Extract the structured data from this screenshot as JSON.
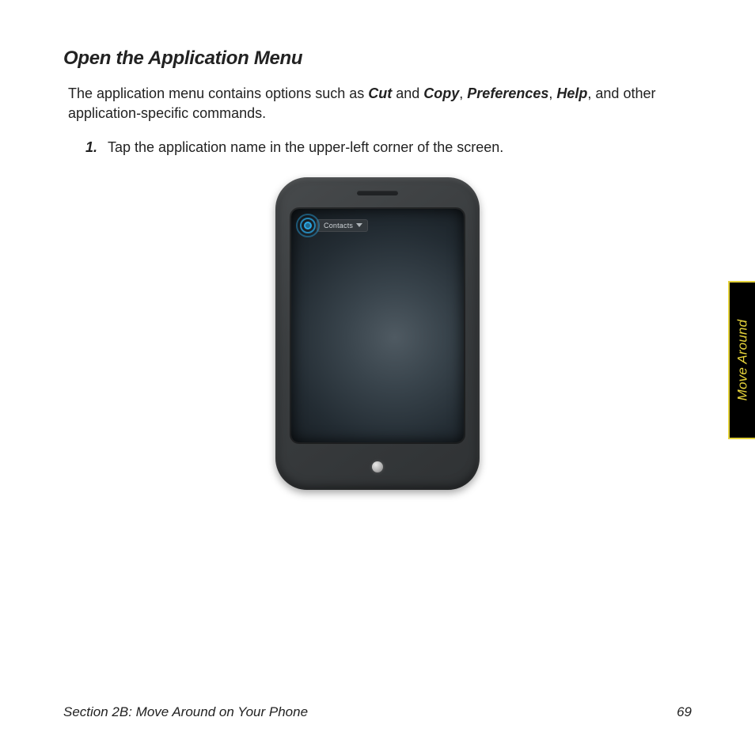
{
  "heading": "Open the Application Menu",
  "intro": {
    "pre": "The application menu contains options such as ",
    "em1": "Cut",
    "mid1": " and ",
    "em2": "Copy",
    "sep1": ", ",
    "em3": "Preferences",
    "sep2": ", ",
    "em4": "Help",
    "post": ", and other application-specific commands."
  },
  "steps": [
    {
      "num": "1.",
      "text": "Tap the application name in the upper-left corner of the screen."
    }
  ],
  "figure": {
    "app_menu_label": "Contacts"
  },
  "side_tab": "Move Around",
  "footer": {
    "section": "Section 2B: Move Around on Your Phone",
    "page": "69"
  }
}
